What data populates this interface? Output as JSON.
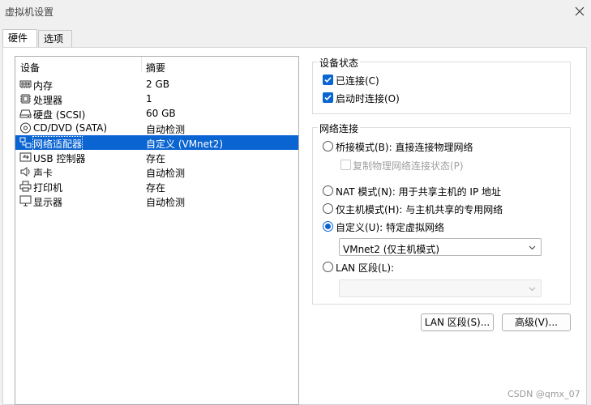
{
  "window": {
    "title": "虚拟机设置"
  },
  "tabs": [
    {
      "label": "硬件"
    },
    {
      "label": "选项"
    }
  ],
  "device_list": {
    "columns": {
      "device": "设备",
      "summary": "摘要"
    },
    "rows": [
      {
        "name": "内存",
        "summary": "2 GB",
        "icon": "memory-icon"
      },
      {
        "name": "处理器",
        "summary": "1",
        "icon": "cpu-icon"
      },
      {
        "name": "硬盘 (SCSI)",
        "summary": "60 GB",
        "icon": "hard-disk-icon"
      },
      {
        "name": "CD/DVD (SATA)",
        "summary": "自动检测",
        "icon": "cd-dvd-icon"
      },
      {
        "name": "网络适配器",
        "summary": "自定义 (VMnet2)",
        "icon": "network-adapter-icon",
        "selected": true
      },
      {
        "name": "USB 控制器",
        "summary": "存在",
        "icon": "usb-icon"
      },
      {
        "name": "声卡",
        "summary": "自动检测",
        "icon": "speaker-icon"
      },
      {
        "name": "打印机",
        "summary": "存在",
        "icon": "printer-icon"
      },
      {
        "name": "显示器",
        "summary": "自动检测",
        "icon": "monitor-icon"
      }
    ]
  },
  "device_status": {
    "title": "设备状态",
    "connected": {
      "label": "已连接(C)",
      "checked": true
    },
    "connect_at_power_on": {
      "label": "启动时连接(O)",
      "checked": true
    }
  },
  "network_connection": {
    "title": "网络连接",
    "bridged": {
      "label": "桥接模式(B): 直接连接物理网络",
      "selected": false
    },
    "replicate": {
      "label": "复制物理网络连接状态(P)",
      "checked": false,
      "disabled": true
    },
    "nat": {
      "label": "NAT 模式(N): 用于共享主机的 IP 地址",
      "selected": false
    },
    "host_only": {
      "label": "仅主机模式(H): 与主机共享的专用网络",
      "selected": false
    },
    "custom": {
      "label": "自定义(U): 特定虚拟网络",
      "selected": true
    },
    "custom_network_value": "VMnet2 (仅主机模式)",
    "lan_segment": {
      "label": "LAN 区段(L):",
      "selected": false
    },
    "lan_segment_value": ""
  },
  "buttons": {
    "lan_segments": "LAN 区段(S)...",
    "advanced": "高级(V)..."
  },
  "watermark": "CSDN @qmx_07",
  "colors": {
    "accent": "#0a64d2",
    "background": "#f0f0f0"
  }
}
